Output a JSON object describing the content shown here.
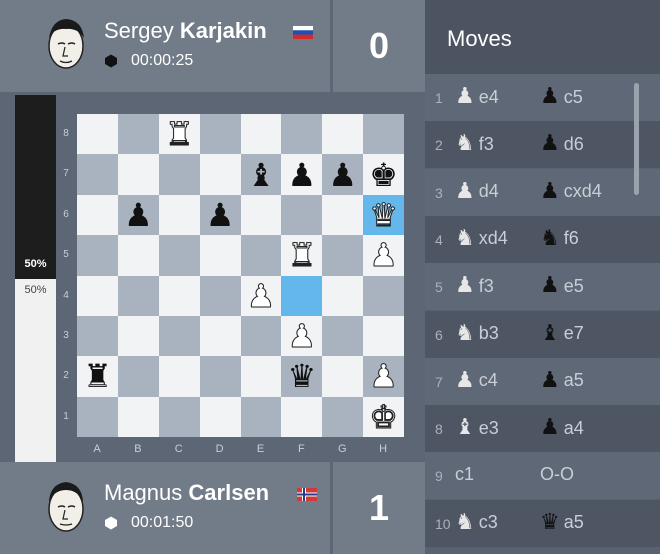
{
  "top_player": {
    "first_name": "Sergey",
    "last_name": "Karjakin",
    "clock": "00:00:25",
    "score": "0",
    "side": "black",
    "flag": "russia-flag"
  },
  "bottom_player": {
    "first_name": "Magnus",
    "last_name": "Carlsen",
    "clock": "00:01:50",
    "score": "1",
    "side": "white",
    "flag": "norway-flag"
  },
  "eval": {
    "black_pct": "50%",
    "white_pct": "50%"
  },
  "board": {
    "files": [
      "A",
      "B",
      "C",
      "D",
      "E",
      "F",
      "G",
      "H"
    ],
    "ranks": [
      "8",
      "7",
      "6",
      "5",
      "4",
      "3",
      "2",
      "1"
    ],
    "highlighted": [
      "h6",
      "f4"
    ],
    "pieces": [
      {
        "square": "c8",
        "color": "white",
        "type": "rook",
        "glyph": "♜"
      },
      {
        "square": "e7",
        "color": "black",
        "type": "bishop",
        "glyph": "♝"
      },
      {
        "square": "f7",
        "color": "black",
        "type": "pawn",
        "glyph": "♟"
      },
      {
        "square": "g7",
        "color": "black",
        "type": "pawn",
        "glyph": "♟"
      },
      {
        "square": "h7",
        "color": "black",
        "type": "king",
        "glyph": "♚"
      },
      {
        "square": "b6",
        "color": "black",
        "type": "pawn",
        "glyph": "♟"
      },
      {
        "square": "d6",
        "color": "black",
        "type": "pawn",
        "glyph": "♟"
      },
      {
        "square": "h6",
        "color": "white",
        "type": "queen",
        "glyph": "♛"
      },
      {
        "square": "f5",
        "color": "white",
        "type": "rook",
        "glyph": "♜"
      },
      {
        "square": "h5",
        "color": "white",
        "type": "pawn",
        "glyph": "♟"
      },
      {
        "square": "e4",
        "color": "white",
        "type": "pawn",
        "glyph": "♟"
      },
      {
        "square": "f3",
        "color": "white",
        "type": "pawn",
        "glyph": "♟"
      },
      {
        "square": "a2",
        "color": "black",
        "type": "rook",
        "glyph": "♜"
      },
      {
        "square": "f2",
        "color": "black",
        "type": "queen",
        "glyph": "♛"
      },
      {
        "square": "h2",
        "color": "white",
        "type": "pawn",
        "glyph": "♟"
      },
      {
        "square": "h1",
        "color": "white",
        "type": "king",
        "glyph": "♚"
      }
    ]
  },
  "moves": {
    "title": "Moves",
    "list": [
      {
        "num": "1",
        "white": {
          "piece": "pawn",
          "glyph": "♟",
          "san": "e4"
        },
        "black": {
          "piece": "pawn",
          "glyph": "♟",
          "san": "c5"
        }
      },
      {
        "num": "2",
        "white": {
          "piece": "knight",
          "glyph": "♞",
          "san": "f3"
        },
        "black": {
          "piece": "pawn",
          "glyph": "♟",
          "san": "d6"
        }
      },
      {
        "num": "3",
        "white": {
          "piece": "pawn",
          "glyph": "♟",
          "san": "d4"
        },
        "black": {
          "piece": "pawn",
          "glyph": "♟",
          "san": "cxd4"
        }
      },
      {
        "num": "4",
        "white": {
          "piece": "knight",
          "glyph": "♞",
          "san": "xd4"
        },
        "black": {
          "piece": "knight",
          "glyph": "♞",
          "san": "f6"
        }
      },
      {
        "num": "5",
        "white": {
          "piece": "pawn",
          "glyph": "♟",
          "san": "f3"
        },
        "black": {
          "piece": "pawn",
          "glyph": "♟",
          "san": "e5"
        }
      },
      {
        "num": "6",
        "white": {
          "piece": "knight",
          "glyph": "♞",
          "san": "b3"
        },
        "black": {
          "piece": "bishop",
          "glyph": "♝",
          "san": "e7"
        }
      },
      {
        "num": "7",
        "white": {
          "piece": "pawn",
          "glyph": "♟",
          "san": "c4"
        },
        "black": {
          "piece": "pawn",
          "glyph": "♟",
          "san": "a5"
        }
      },
      {
        "num": "8",
        "white": {
          "piece": "bishop",
          "glyph": "♝",
          "san": "e3"
        },
        "black": {
          "piece": "pawn",
          "glyph": "♟",
          "san": "a4"
        }
      },
      {
        "num": "9",
        "white": {
          "piece": "",
          "glyph": "",
          "san": "c1"
        },
        "black": {
          "piece": "",
          "glyph": "",
          "san": "O-O"
        }
      },
      {
        "num": "10",
        "white": {
          "piece": "knight",
          "glyph": "♞",
          "san": "c3"
        },
        "black": {
          "piece": "queen",
          "glyph": "♛",
          "san": "a5"
        }
      }
    ]
  },
  "colors": {
    "highlight": "#64b7ea",
    "light_square": "#f2f3f5",
    "dark_square": "#a9b2bf"
  }
}
